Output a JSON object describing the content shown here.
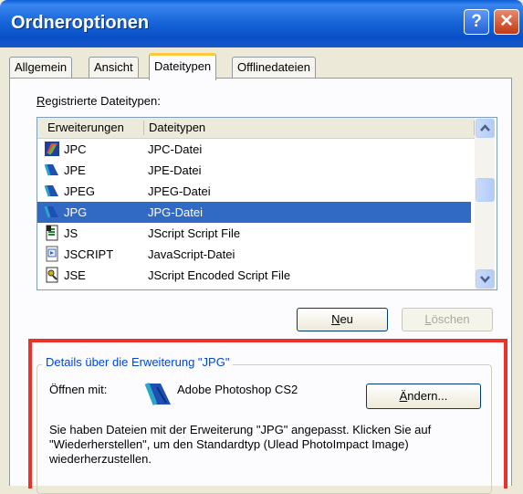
{
  "window": {
    "title": "Ordneroptionen"
  },
  "titlebar": {
    "help_glyph": "?",
    "close_glyph": "✕"
  },
  "tabs": [
    {
      "label": "Allgemein",
      "active": false
    },
    {
      "label": "Ansicht",
      "active": false
    },
    {
      "label": "Dateitypen",
      "active": true
    },
    {
      "label": "Offlinedateien",
      "active": false
    }
  ],
  "registered": {
    "label_first": "R",
    "label_rest": "egistrierte Dateitypen:",
    "columns": {
      "ext": "Erweiterungen",
      "type": "Dateitypen"
    },
    "rows": [
      {
        "ext": "JPC",
        "type": "JPC-Datei",
        "icon": "photoshop-doc-icon",
        "selected": false
      },
      {
        "ext": "JPE",
        "type": "JPE-Datei",
        "icon": "photoshop-doc-icon",
        "selected": false
      },
      {
        "ext": "JPEG",
        "type": "JPEG-Datei",
        "icon": "photoshop-doc-icon",
        "selected": false
      },
      {
        "ext": "JPG",
        "type": "JPG-Datei",
        "icon": "photoshop-doc-icon",
        "selected": true
      },
      {
        "ext": "JS",
        "type": "JScript Script File",
        "icon": "script-file-icon",
        "selected": false
      },
      {
        "ext": "JSCRIPT",
        "type": "JavaScript-Datei",
        "icon": "generic-file-icon",
        "selected": false
      },
      {
        "ext": "JSE",
        "type": "JScript Encoded Script File",
        "icon": "encoded-script-icon",
        "selected": false
      }
    ]
  },
  "buttons": {
    "new_first": "N",
    "new_rest": "eu",
    "delete_first": "L",
    "delete_rest": "öschen",
    "change_first": "Ä",
    "change_rest": "ndern..."
  },
  "details": {
    "legend": "Details über die Erweiterung \"JPG\"",
    "open_with_label": "Öffnen mit:",
    "app_name": "Adobe Photoshop CS2",
    "description": "Sie haben Dateien mit der Erweiterung \"JPG\" angepasst. Klicken Sie auf \"Wiederherstellen\", um den Standardtyp (Ulead PhotoImpact Image) wiederherzustellen."
  },
  "colors": {
    "highlight": "#316ac5",
    "annotation": "#e8322a",
    "tab_accent": "#ffc83c"
  }
}
